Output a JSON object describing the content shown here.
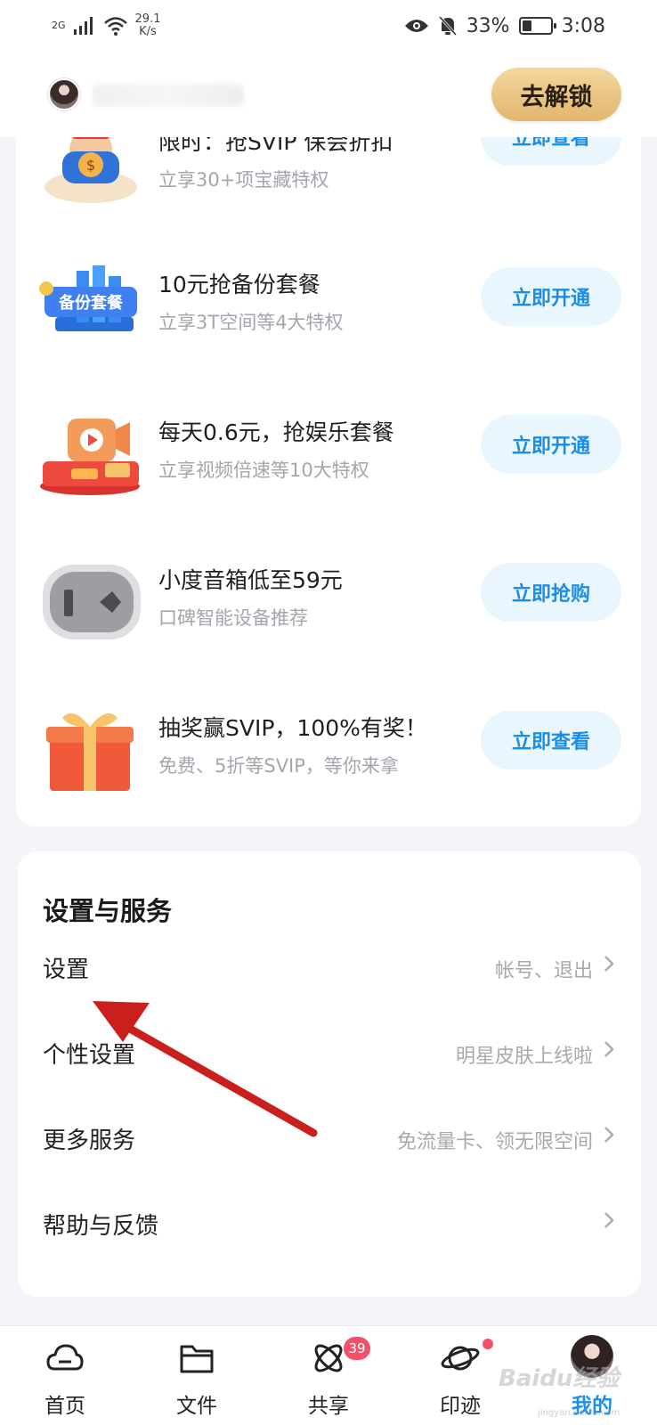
{
  "status_bar": {
    "network": "2G",
    "speed_value": "29.1",
    "speed_unit": "K/s",
    "battery_percent": "33%",
    "battery_level": 0.33,
    "time": "3:08"
  },
  "header": {
    "unlock_label": "去解锁"
  },
  "promos": [
    {
      "title": "限时：抢SVIP 保会折扣",
      "subtitle": "立享30+项宝藏特权",
      "button": "立即查看",
      "icon": "money-bag-doll-icon"
    },
    {
      "title": "10元抢备份套餐",
      "subtitle": "立享3T空间等4大特权",
      "button": "立即开通",
      "icon": "backup-package-icon"
    },
    {
      "title": "每天0.6元，抢娱乐套餐",
      "subtitle": "立享视频倍速等10大特权",
      "button": "立即开通",
      "icon": "video-camera-icon"
    },
    {
      "title": "小度音箱低至59元",
      "subtitle": "口碑智能设备推荐",
      "button": "立即抢购",
      "icon": "speaker-icon"
    },
    {
      "title": "抽奖赢SVIP，100%有奖！",
      "subtitle": "免费、5折等SVIP，等你来拿",
      "button": "立即查看",
      "icon": "gift-box-icon"
    }
  ],
  "settings": {
    "title": "设置与服务",
    "rows": [
      {
        "label": "设置",
        "hint": "帐号、退出"
      },
      {
        "label": "个性设置",
        "hint": "明星皮肤上线啦"
      },
      {
        "label": "更多服务",
        "hint": "免流量卡、领无限空间"
      },
      {
        "label": "帮助与反馈",
        "hint": ""
      }
    ]
  },
  "bottom_nav": {
    "items": [
      {
        "label": "首页",
        "icon": "cloud-home-icon"
      },
      {
        "label": "文件",
        "icon": "folder-icon"
      },
      {
        "label": "共享",
        "icon": "share-orbit-icon",
        "badge": "39"
      },
      {
        "label": "印迹",
        "icon": "planet-icon"
      },
      {
        "label": "我的",
        "icon": "profile-avatar-icon",
        "active": true
      }
    ]
  },
  "watermark": {
    "text": "Baidu经验",
    "sub": "jingyan.baidu.com"
  },
  "colors": {
    "accent": "#1e8fe8",
    "button_bg": "#eaf6fd",
    "unlock_gold": "#e2b66d",
    "badge_red": "#f5506a",
    "annotation_red": "#c9201e"
  }
}
